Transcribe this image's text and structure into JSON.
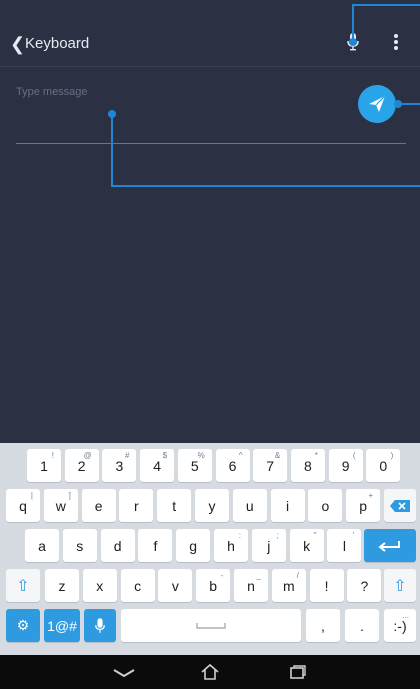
{
  "app_bar": {
    "back_icon": "chevron-left-icon",
    "title": "Keyboard",
    "mic_icon": "microphone-icon",
    "more_icon": "more-vertical-icon"
  },
  "message": {
    "placeholder": "Type message",
    "send_icon": "send-icon"
  },
  "keyboard": {
    "row1": [
      {
        "main": "1",
        "alt": "!"
      },
      {
        "main": "2",
        "alt": "@"
      },
      {
        "main": "3",
        "alt": "#"
      },
      {
        "main": "4",
        "alt": "$"
      },
      {
        "main": "5",
        "alt": "%"
      },
      {
        "main": "6",
        "alt": "^"
      },
      {
        "main": "7",
        "alt": "&"
      },
      {
        "main": "8",
        "alt": "*"
      },
      {
        "main": "9",
        "alt": "("
      },
      {
        "main": "0",
        "alt": ")"
      }
    ],
    "row2": [
      {
        "main": "q",
        "alt": "|"
      },
      {
        "main": "w",
        "alt": "]"
      },
      {
        "main": "e",
        "alt": ""
      },
      {
        "main": "r",
        "alt": ""
      },
      {
        "main": "t",
        "alt": ""
      },
      {
        "main": "y",
        "alt": ""
      },
      {
        "main": "u",
        "alt": ""
      },
      {
        "main": "i",
        "alt": ""
      },
      {
        "main": "o",
        "alt": ""
      },
      {
        "main": "p",
        "alt": "+"
      }
    ],
    "row3": [
      {
        "main": "a",
        "alt": ""
      },
      {
        "main": "s",
        "alt": ""
      },
      {
        "main": "d",
        "alt": ""
      },
      {
        "main": "f",
        "alt": ""
      },
      {
        "main": "g",
        "alt": ""
      },
      {
        "main": "h",
        "alt": ":"
      },
      {
        "main": "j",
        "alt": ";"
      },
      {
        "main": "k",
        "alt": "\""
      },
      {
        "main": "l",
        "alt": "'"
      }
    ],
    "row4": [
      {
        "main": "z",
        "alt": ""
      },
      {
        "main": "x",
        "alt": ""
      },
      {
        "main": "c",
        "alt": ""
      },
      {
        "main": "v",
        "alt": ""
      },
      {
        "main": "b",
        "alt": "-"
      },
      {
        "main": "n",
        "alt": "_"
      },
      {
        "main": "m",
        "alt": "/"
      },
      {
        "main": "!",
        "alt": ""
      },
      {
        "main": "?",
        "alt": ""
      }
    ],
    "row5": {
      "settings_icon": "gear-icon",
      "symbols_label": "1@#",
      "voice_icon": "microphone-icon",
      "space_icon": "spacebar-icon",
      "comma": ",",
      "period": ".",
      "emoticon": ":-)",
      "emoticon_alt": "..."
    },
    "backspace_icon": "backspace-icon",
    "enter_icon": "enter-icon",
    "shift_icon": "shift-icon"
  },
  "nav_bar": {
    "back_icon": "nav-back-icon",
    "home_icon": "home-icon",
    "recents_icon": "recents-icon"
  },
  "colors": {
    "background": "#2b3142",
    "accent": "#2aa4e9",
    "keyboard": "#d6dbe2",
    "callout": "#1f86d6"
  }
}
